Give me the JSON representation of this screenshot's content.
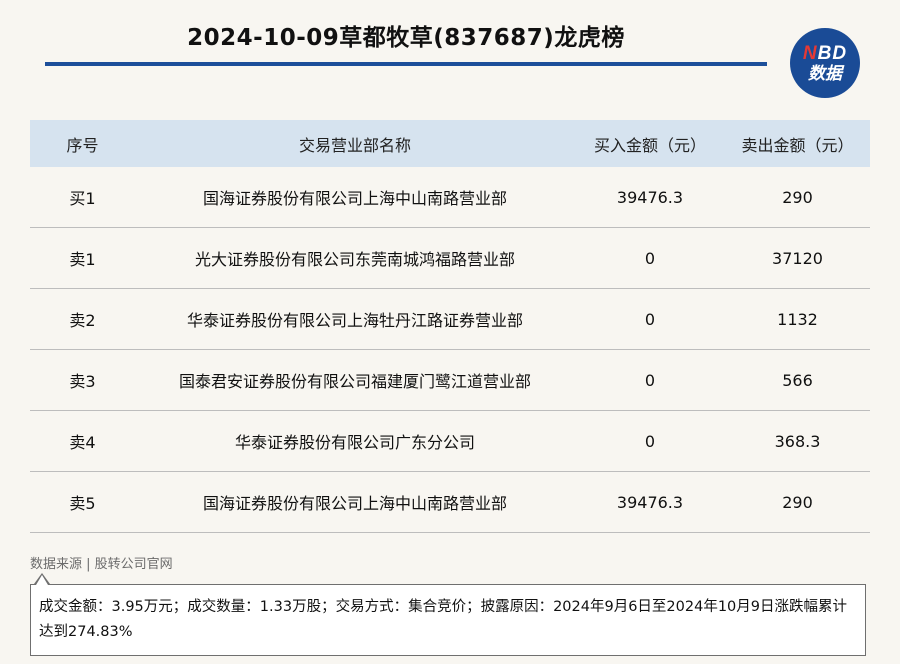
{
  "header": {
    "title": "2024-10-09草都牧草(837687)龙虎榜"
  },
  "logo": {
    "line1_a": "N",
    "line1_b": "BD",
    "line2": "数据"
  },
  "table": {
    "columns": [
      "序号",
      "交易营业部名称",
      "买入金额（元）",
      "卖出金额（元）"
    ],
    "rows": [
      [
        "买1",
        "国海证券股份有限公司上海中山南路营业部",
        "39476.3",
        "290"
      ],
      [
        "卖1",
        "光大证券股份有限公司东莞南城鸿福路营业部",
        "0",
        "37120"
      ],
      [
        "卖2",
        "华泰证券股份有限公司上海牡丹江路证券营业部",
        "0",
        "1132"
      ],
      [
        "卖3",
        "国泰君安证券股份有限公司福建厦门鹭江道营业部",
        "0",
        "566"
      ],
      [
        "卖4",
        "华泰证券股份有限公司广东分公司",
        "0",
        "368.3"
      ],
      [
        "卖5",
        "国海证券股份有限公司上海中山南路营业部",
        "39476.3",
        "290"
      ]
    ]
  },
  "footer": {
    "source": "数据来源 | 股转公司官网",
    "note": "成交金额：3.95万元；成交数量：1.33万股；交易方式：集合竞价；披露原因：2024年9月6日至2024年10月9日涨跌幅累计达到274.83%"
  },
  "colors": {
    "accent": "#1d4f9a",
    "header_bg": "#d6e3ef",
    "logo_bg": "#1a4b96",
    "logo_red": "#e53935"
  }
}
